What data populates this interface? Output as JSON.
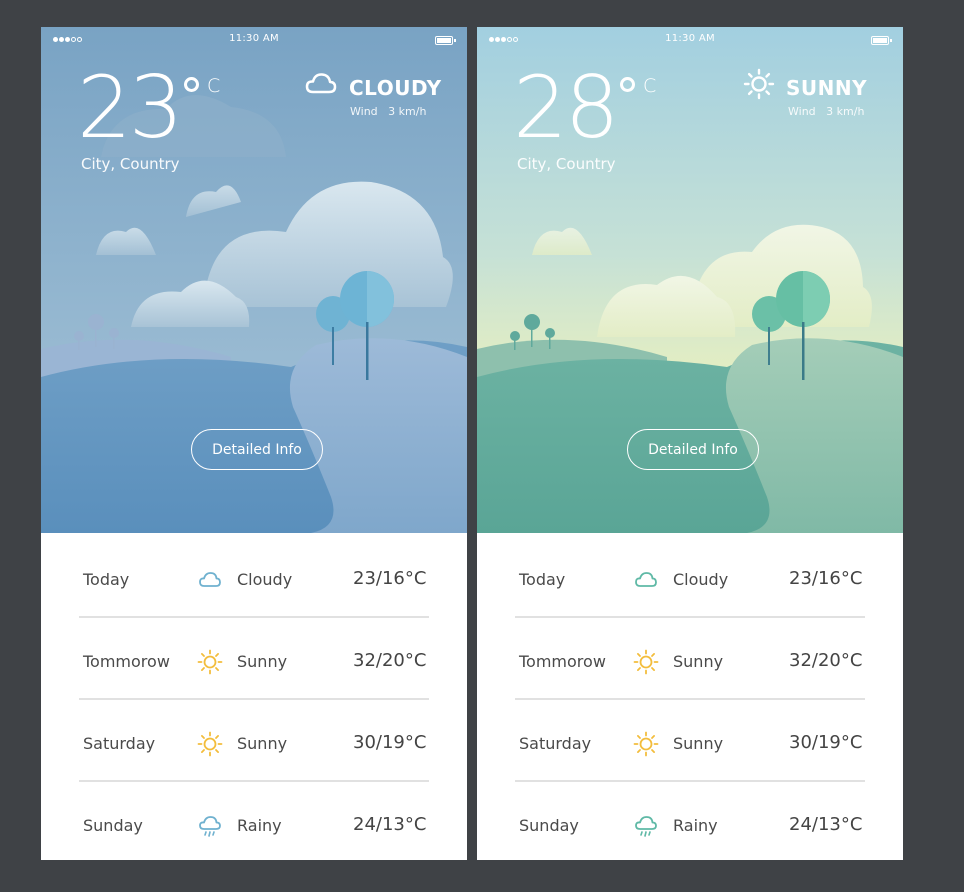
{
  "screens": [
    {
      "status": {
        "time": "11:30 AM"
      },
      "temperature": "23",
      "unit": "C",
      "location": "City, Country",
      "condition": {
        "label": "CLOUDY",
        "icon": "cloud-icon"
      },
      "wind": {
        "label": "Wind",
        "value": "3 km/h"
      },
      "detail_button": "Detailed Info",
      "forecast": [
        {
          "day": "Today",
          "icon": "cloud-icon",
          "condition": "Cloudy",
          "temps": "23/16°C"
        },
        {
          "day": "Tommorow",
          "icon": "sun-icon",
          "condition": "Sunny",
          "temps": "32/20°C"
        },
        {
          "day": "Saturday",
          "icon": "sun-icon",
          "condition": "Sunny",
          "temps": "30/19°C"
        },
        {
          "day": "Sunday",
          "icon": "rain-cloud-icon",
          "condition": "Rainy",
          "temps": "24/13°C"
        }
      ]
    },
    {
      "status": {
        "time": "11:30 AM"
      },
      "temperature": "28",
      "unit": "C",
      "location": "City, Country",
      "condition": {
        "label": "SUNNY",
        "icon": "sun-icon"
      },
      "wind": {
        "label": "Wind",
        "value": "3 km/h"
      },
      "detail_button": "Detailed Info",
      "forecast": [
        {
          "day": "Today",
          "icon": "cloud-icon",
          "condition": "Cloudy",
          "temps": "23/16°C"
        },
        {
          "day": "Tommorow",
          "icon": "sun-icon",
          "condition": "Sunny",
          "temps": "32/20°C"
        },
        {
          "day": "Saturday",
          "icon": "sun-icon",
          "condition": "Sunny",
          "temps": "30/19°C"
        },
        {
          "day": "Sunday",
          "icon": "rain-cloud-icon",
          "condition": "Rainy",
          "temps": "24/13°C"
        }
      ]
    }
  ],
  "colors": {
    "background": "#3f4246",
    "cloudy_sky_top": "#7aa4c5",
    "cloudy_ground": "#5f93bf",
    "sunny_sky_top": "#a3cfe0",
    "sunny_sky_bottom": "#e6efc1",
    "sunny_ground": "#5fa99c",
    "cloudy_accent": "#6fb1cf",
    "sunny_accent": "#5fb9a6",
    "sun_icon": "#f3bd3c"
  }
}
